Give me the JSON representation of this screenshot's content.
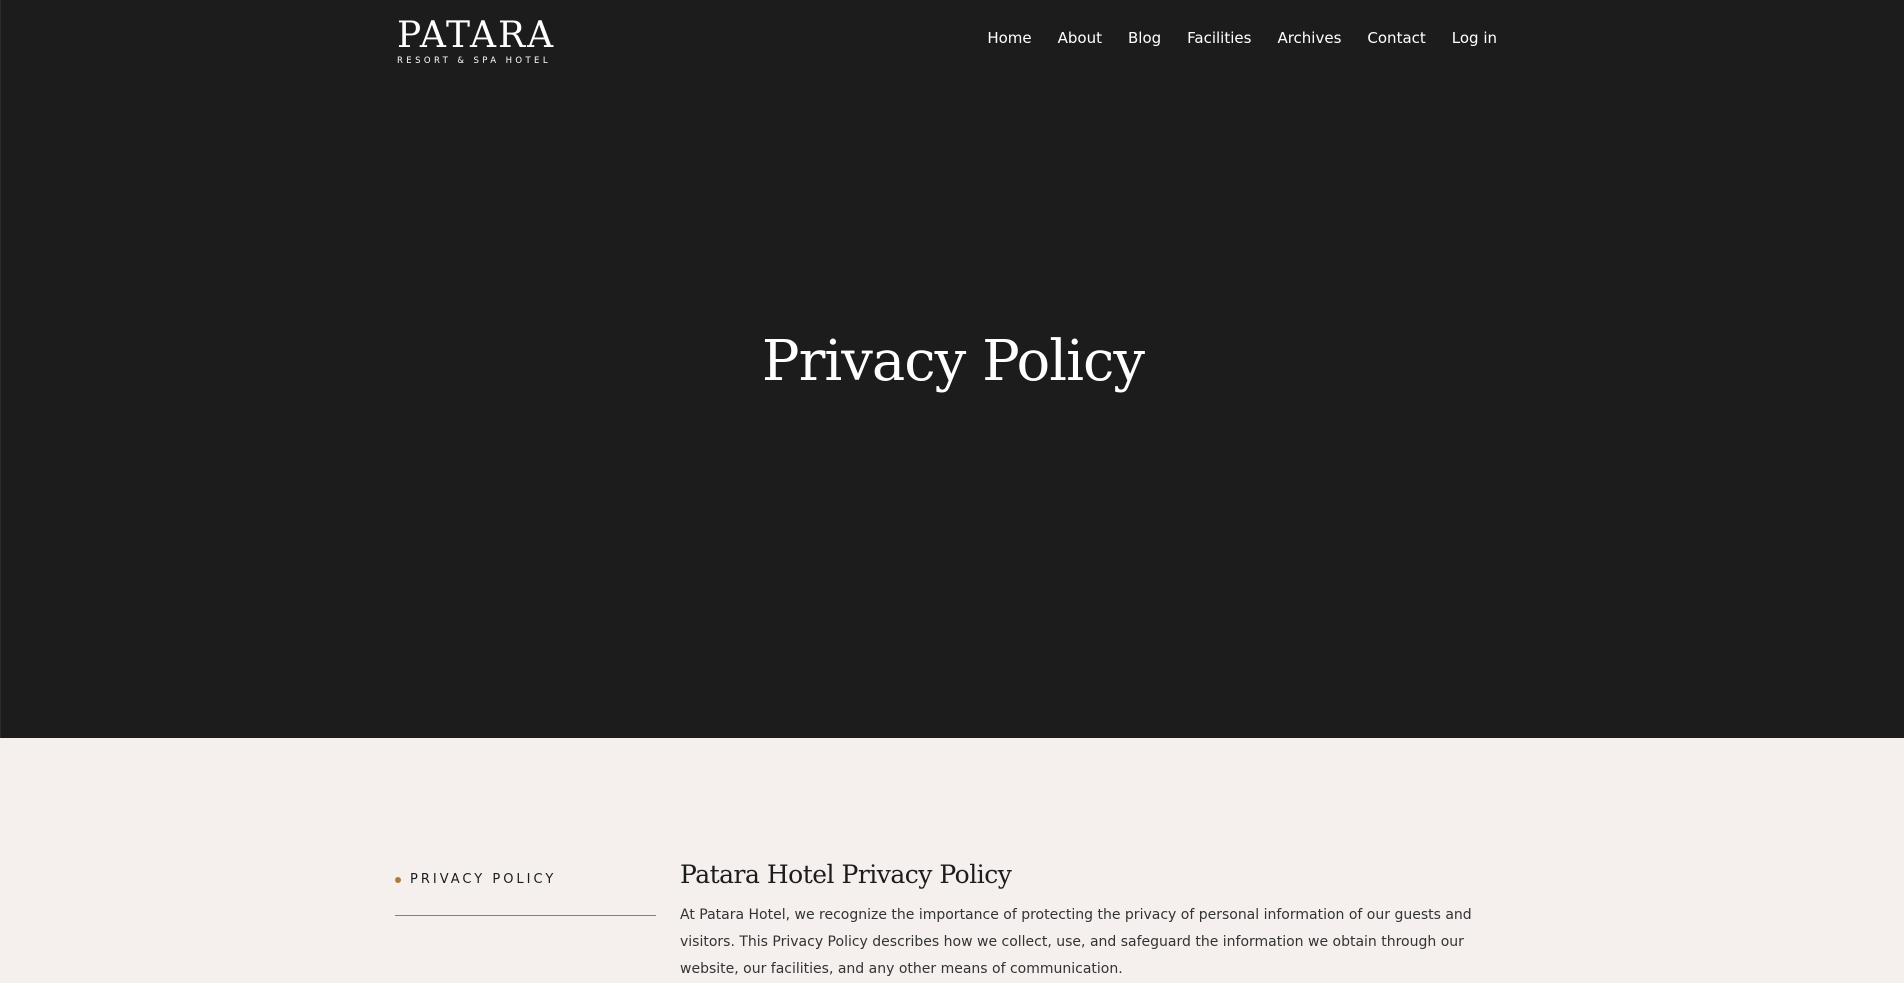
{
  "brand": {
    "name": "PATARA",
    "tagline": "RESORT & SPA HOTEL"
  },
  "nav": {
    "items": [
      {
        "label": "Home"
      },
      {
        "label": "About"
      },
      {
        "label": "Blog"
      },
      {
        "label": "Facilities"
      },
      {
        "label": "Archives"
      },
      {
        "label": "Contact"
      },
      {
        "label": "Log in"
      }
    ]
  },
  "hero": {
    "title": "Privacy Policy"
  },
  "sidebar": {
    "items": [
      {
        "label": "PRIVACY POLICY"
      }
    ]
  },
  "article": {
    "title": "Patara Hotel Privacy Policy",
    "intro": "At Patara Hotel, we recognize the importance of protecting the privacy of personal information of our guests and visitors. This Privacy Policy describes how we collect, use, and safeguard the information we obtain through our website, our facilities, and any other means of communication."
  },
  "colors": {
    "hero_background": "#1c1c1c",
    "page_background": "#f5efee",
    "accent": "#b07a3a"
  }
}
